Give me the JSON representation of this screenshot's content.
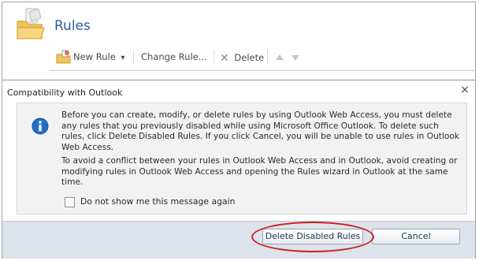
{
  "page": {
    "title": "Rules"
  },
  "toolbar": {
    "new_rule": "New Rule",
    "new_rule_arrow": "▾",
    "change_rule": "Change Rule...",
    "delete": "Delete"
  },
  "dialog": {
    "title": "Compatibility with Outlook",
    "close": "×",
    "message1": "Before you can create, modify, or delete rules by using Outlook Web Access, you must delete any rules that you previously disabled while using Microsoft Office Outlook. To delete such rules, click Delete Disabled Rules. If you click Cancel, you will be unable to use rules in Outlook Web Access.",
    "message2": "To avoid a conflict between your rules in Outlook Web Access and in Outlook, avoid creating or modifying rules in Outlook Web Access and opening the Rules wizard in Outlook at the same time.",
    "checkbox_label": "Do not show me this message again",
    "checkbox_checked": false,
    "delete_button": "Delete Disabled Rules",
    "cancel_button": "Cancel"
  },
  "icons": {
    "title_icon": "folder-icon",
    "new_rule_icon": "new-rule-folder-icon",
    "delete_icon": "delete-x-icon",
    "up_icon": "move-up-icon",
    "down_icon": "move-down-icon",
    "info_icon": "info-icon"
  },
  "colors": {
    "title": "#2b5aa6",
    "highlight": "#cc1f1f",
    "info": "#1f6fc6"
  }
}
